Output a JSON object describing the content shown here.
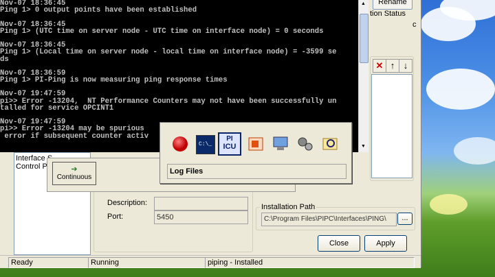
{
  "console": {
    "lines": [
      "Nov-07 18:36:45",
      "Ping 1> 0 output points have been established",
      "",
      "Nov-07 18:36:45",
      "Ping 1> (UTC time on server node - UTC time on interface node) = 0 seconds",
      "",
      "Nov-07 18:36:45",
      "Ping 1> (Local time on server node - local time on interface node) = -3599 se",
      "ds",
      "",
      "Nov-07 18:36:59",
      "Ping 1> PI-Ping is now measuring ping response times",
      "",
      "Nov-07 19:47:59",
      "pi>> Error -13204,  NT Performance Counters may not have been successfully un",
      "talled for service OPCINT1",
      "",
      "Nov-07 19:47:59",
      "pi>> Error -13204 may be spurious",
      " error if subsequent counter activ"
    ]
  },
  "icu": {
    "rename_label": "Rename",
    "status_fragment": "tion Status",
    "c_fragment": "c",
    "list_items": [
      "Interface S",
      "Control Pro"
    ],
    "description_label": "Description:",
    "description_value": "",
    "port_label": "Port:",
    "port_value": "5450",
    "install_path_label": "Installation Path",
    "install_path_value": "C:\\Program Files\\PIPC\\Interfaces\\PING\\",
    "browse_label": "...",
    "close_label": "Close",
    "apply_label": "Apply",
    "status_ready": "Ready",
    "status_running": "Running",
    "status_installed": "piping - Installed"
  },
  "popup": {
    "log_files_label": "Log Files",
    "icons": [
      "stop-icon",
      "console-icon",
      "pi-icu-icon",
      "office-icon",
      "computer-icon",
      "services-icon",
      "search-icon"
    ],
    "pi_line1": "PI",
    "pi_line2": "ICU",
    "console_text": "C:\\_"
  },
  "continuous_label": "Continuous",
  "colors": {
    "console_bg": "#000000",
    "console_fg": "#c0c0c0",
    "selected_icon": "#0a246a"
  }
}
